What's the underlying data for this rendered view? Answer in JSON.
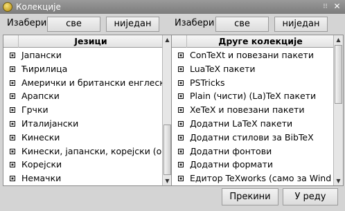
{
  "window": {
    "title": "Колекције",
    "icons": [
      "app-icon",
      "pin-icon",
      "close-icon"
    ]
  },
  "left": {
    "select_label": "Изабери",
    "all_label": "све",
    "none_label": "ниједан",
    "header": "Језици",
    "items": [
      "Јапански",
      "Ћирилица",
      "Амерички и британски енглески",
      "Арапски",
      "Грчки",
      "Италијански",
      "Кинески",
      "Кинески, јапански, корејски (о",
      "Корејски",
      "Немачки"
    ]
  },
  "right": {
    "select_label": "Изабери",
    "all_label": "све",
    "none_label": "ниједан",
    "header": "Друге колекције",
    "items": [
      "ConTeXt и повезани пакети",
      "LuaTeX пакети",
      "PSTricks",
      "Plain (чисти) (La)TeX пакети",
      "XeTeX и повезани пакети",
      "Додатни LaTeX пакети",
      "Додатни стилови за BibTeX",
      "Додатни фонтови",
      "Додатни формати",
      "Едитор TeXworks (само за Wind"
    ]
  },
  "footer": {
    "cancel_label": "Прекини",
    "ok_label": "У реду"
  },
  "left_scroll_fraction": 0.62,
  "right_scroll_fraction": 0.0
}
